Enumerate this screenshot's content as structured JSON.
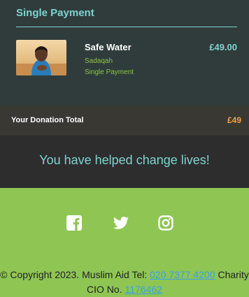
{
  "basket": {
    "heading": "Single Payment",
    "items": [
      {
        "name": "Safe Water",
        "category": "Sadaqah",
        "frequency": "Single Payment",
        "price": "£49.00"
      }
    ]
  },
  "total": {
    "label": "Your Donation Total",
    "amount": "£49"
  },
  "thanks": {
    "message": "You have helped change lives!"
  },
  "footer": {
    "social": [
      "facebook-icon",
      "twitter-icon",
      "instagram-icon"
    ],
    "copyright_prefix": "© Copyright 2023. Muslim Aid Tel: ",
    "phone": "020 7377 4200",
    "charity_text": " Charity CIO No. ",
    "charity_number": "1176462"
  },
  "colors": {
    "accent_teal": "#7fd3d0",
    "accent_green": "#8ec553",
    "total_orange": "#f0a23a"
  }
}
